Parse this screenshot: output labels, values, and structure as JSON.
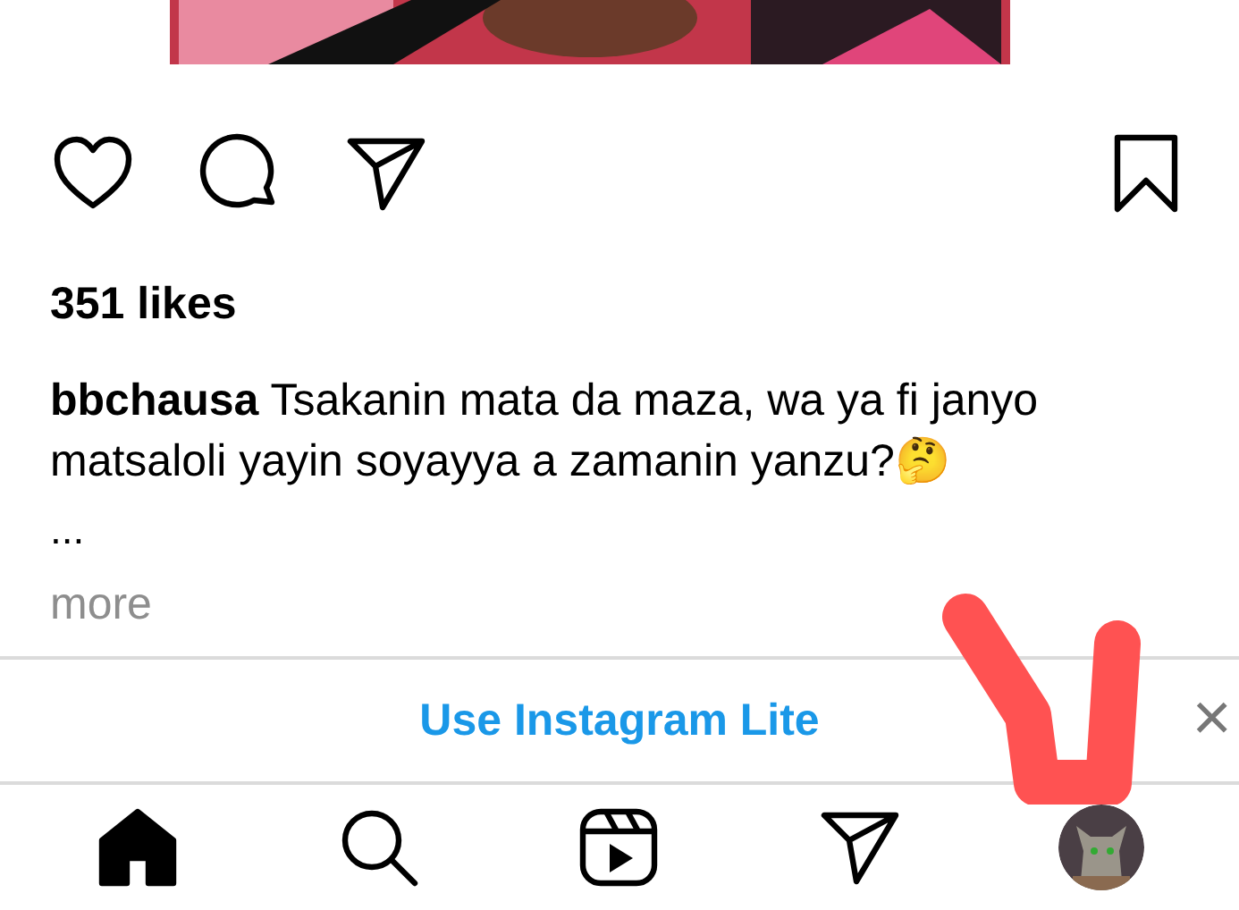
{
  "post": {
    "actions": [
      {
        "kind": "like"
      },
      {
        "kind": "comment"
      },
      {
        "kind": "share"
      },
      {
        "kind": "save"
      }
    ],
    "likes": "351 likes",
    "caption": "**bbchausa** Tsakanin mata da maza, wa ya fi janyo matsaloli yayin soyayya a zamanin yanzu?🤔",
    "ellipsis": "...",
    "more": "more"
  },
  "banner": {
    "label": "Use Instagram Lite",
    "close": "×"
  },
  "nav": [
    {
      "kind": "home"
    },
    {
      "kind": "search"
    },
    {
      "kind": "reels"
    },
    {
      "kind": "messages"
    },
    {
      "kind": "profile"
    }
  ]
}
